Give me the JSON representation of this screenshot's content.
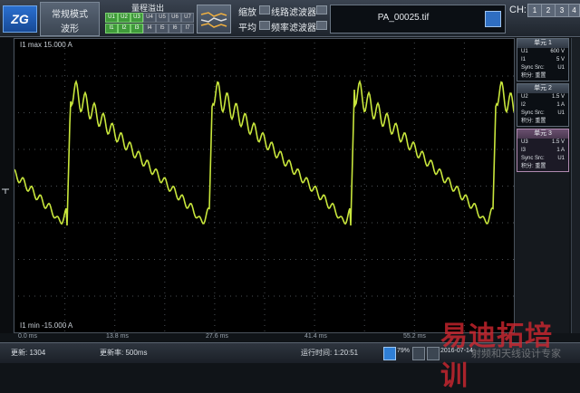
{
  "header": {
    "logo": "ZG",
    "mode": {
      "line1": "常规模式",
      "line2": "波形"
    },
    "range": {
      "title": "量程溢出",
      "row1": [
        "U1",
        "U2",
        "U3",
        "U4",
        "U5",
        "U6",
        "U7"
      ],
      "row2": [
        "I1",
        "I2",
        "I3",
        "I4",
        "I5",
        "I6",
        "I7"
      ]
    },
    "options": [
      {
        "label": "缩放"
      },
      {
        "label": "线路滤波器"
      },
      {
        "label": "平均"
      },
      {
        "label": "频率滤波器"
      }
    ],
    "filename": "PA_00025.tif",
    "ch_label": "CH:",
    "ch_buttons": [
      "1",
      "2",
      "3",
      "4"
    ]
  },
  "plot": {
    "max_label": "I1   max 15.000 A",
    "min_label": "I1   min -15.000 A",
    "ticks": [
      "0.0 ms",
      "13.8 ms",
      "27.6 ms",
      "41.4 ms",
      "55.2 ms"
    ]
  },
  "units": [
    {
      "title": "单元 1",
      "rows": [
        [
          "U1",
          "600 V"
        ],
        [
          "I1",
          "5 V"
        ],
        [
          "Sync Src:",
          "U1"
        ],
        [
          "积分: 重置",
          ""
        ]
      ]
    },
    {
      "title": "单元 2",
      "rows": [
        [
          "U2",
          "1.5 V"
        ],
        [
          "I2",
          "1 A"
        ],
        [
          "Sync Src:",
          "U1"
        ],
        [
          "积分: 重置",
          ""
        ]
      ]
    },
    {
      "title": "单元 3",
      "rows": [
        [
          "U3",
          "1.5 V"
        ],
        [
          "I3",
          "1 A"
        ],
        [
          "Sync Src:",
          "U1"
        ],
        [
          "积分: 重置",
          ""
        ]
      ]
    }
  ],
  "status": {
    "update": "更新:  1304",
    "rate": "更新率:  500ms",
    "runtime": "运行时间:  1:20:51",
    "percent": "79%",
    "date": "2016-07-14"
  },
  "watermark": {
    "line1": "易迪拓培训",
    "line2": "射频和天线设计专家"
  },
  "colors": {
    "trace": "#c8e63c",
    "accent": "#3f9a3a"
  }
}
